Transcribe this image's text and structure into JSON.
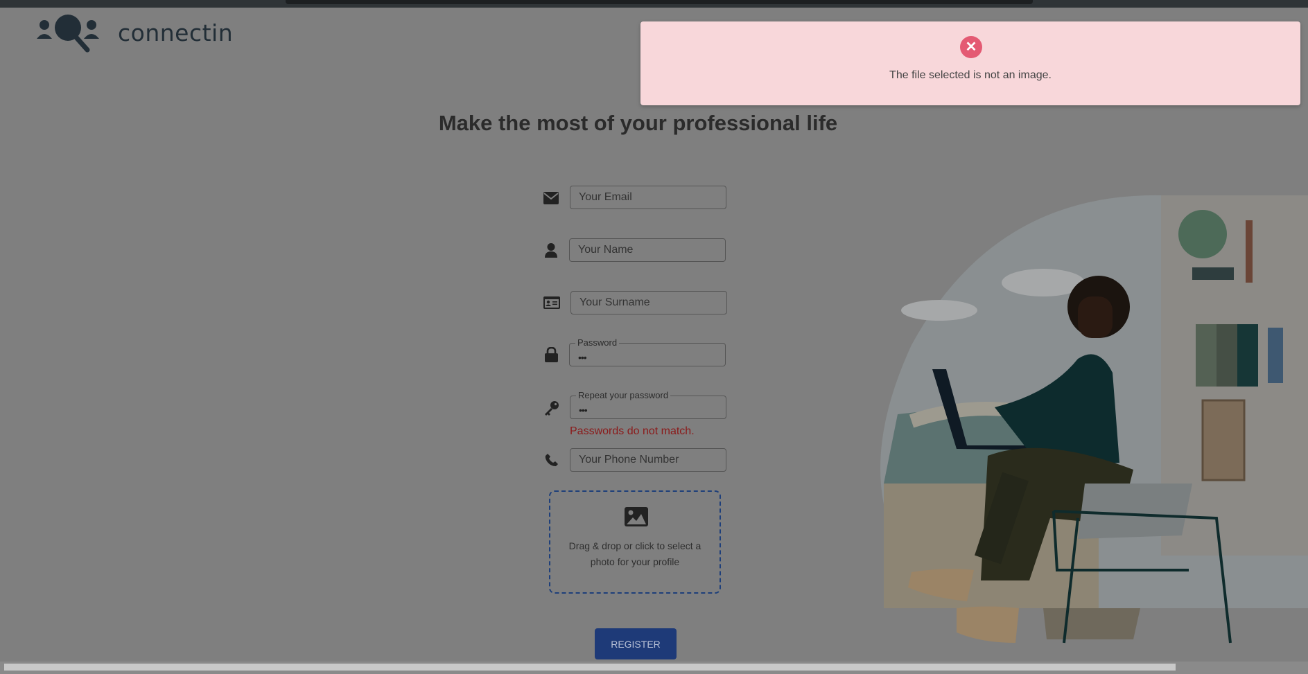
{
  "brand": {
    "name": "connectin"
  },
  "headline": "Make the most of your professional life",
  "form": {
    "email": {
      "placeholder": "Your Email"
    },
    "name": {
      "placeholder": "Your Name"
    },
    "surname": {
      "placeholder": "Your Surname"
    },
    "password": {
      "label": "Password",
      "value": "•••"
    },
    "repeat_password": {
      "label": "Repeat your password",
      "value": "•••"
    },
    "password_error": "Passwords do not match.",
    "phone": {
      "placeholder": "Your Phone Number"
    },
    "photo_dropzone": {
      "text": "Drag & drop or click to select a photo for your profile"
    },
    "register_label": "REGISTER"
  },
  "alert": {
    "message": "The file selected is not an image.",
    "icon": "close-icon",
    "color": "#f8d7da"
  },
  "icons": [
    "envelope-icon",
    "user-icon",
    "id-card-icon",
    "lock-icon",
    "key-icon",
    "phone-icon",
    "image-icon"
  ]
}
